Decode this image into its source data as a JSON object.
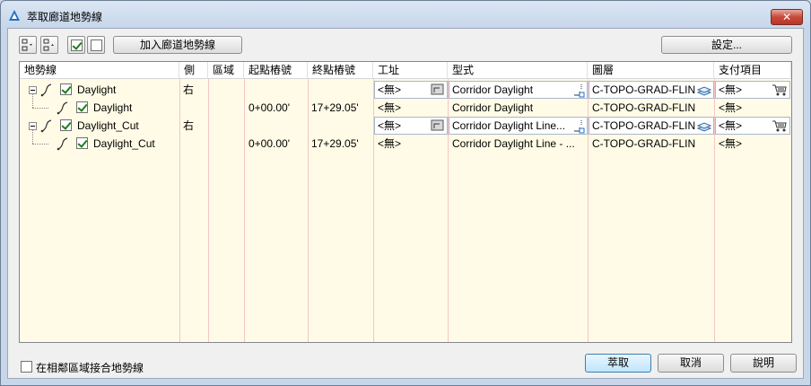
{
  "window": {
    "title": "萃取廊道地勢線",
    "close_label": "✕"
  },
  "toolbar": {
    "add_label": "加入廊道地勢線",
    "settings_label": "設定..."
  },
  "columns": [
    "地勢線",
    "側",
    "區域",
    "起點樁號",
    "終點樁號",
    "工址",
    "型式",
    "圖層",
    "支付項目"
  ],
  "rows": [
    {
      "name": "Daylight",
      "side": "右",
      "region": "",
      "start": "",
      "end": "",
      "site": "<無>",
      "style": "Corridor Daylight",
      "layer": "C-TOPO-GRAD-FLIN",
      "pay": "<無>",
      "level": 0,
      "checked": true
    },
    {
      "name": "Daylight",
      "side": "",
      "region": "",
      "start": "0+00.00'",
      "end": "17+29.05'",
      "site": "<無>",
      "style": "Corridor Daylight",
      "layer": "C-TOPO-GRAD-FLIN",
      "pay": "<無>",
      "level": 1,
      "checked": true
    },
    {
      "name": "Daylight_Cut",
      "side": "右",
      "region": "",
      "start": "",
      "end": "",
      "site": "<無>",
      "style": "Corridor Daylight Line...",
      "layer": "C-TOPO-GRAD-FLIN",
      "pay": "<無>",
      "level": 0,
      "checked": true
    },
    {
      "name": "Daylight_Cut",
      "side": "",
      "region": "",
      "start": "0+00.00'",
      "end": "17+29.05'",
      "site": "<無>",
      "style": "Corridor Daylight Line - ...",
      "layer": "C-TOPO-GRAD-FLIN",
      "pay": "<無>",
      "level": 1,
      "checked": true
    }
  ],
  "footer": {
    "join_label": "在相鄰區域接合地勢線",
    "join_checked": false,
    "extract_label": "萃取",
    "cancel_label": "取消",
    "help_label": "說明"
  },
  "icons": {
    "app": "civil3d-logo-icon",
    "tree_collapse": "collapse-minus-icon",
    "feature_line": "feature-line-icon",
    "site_picker": "site-picker-icon",
    "style_picker": "style-picker-icon",
    "layer_picker": "layer-stack-icon",
    "pay_picker": "pay-item-cart-icon"
  },
  "colors": {
    "grid_bg": "#fffbe6",
    "check_mark": "#1b7d1b",
    "column_divider": "#f3c6c6"
  }
}
